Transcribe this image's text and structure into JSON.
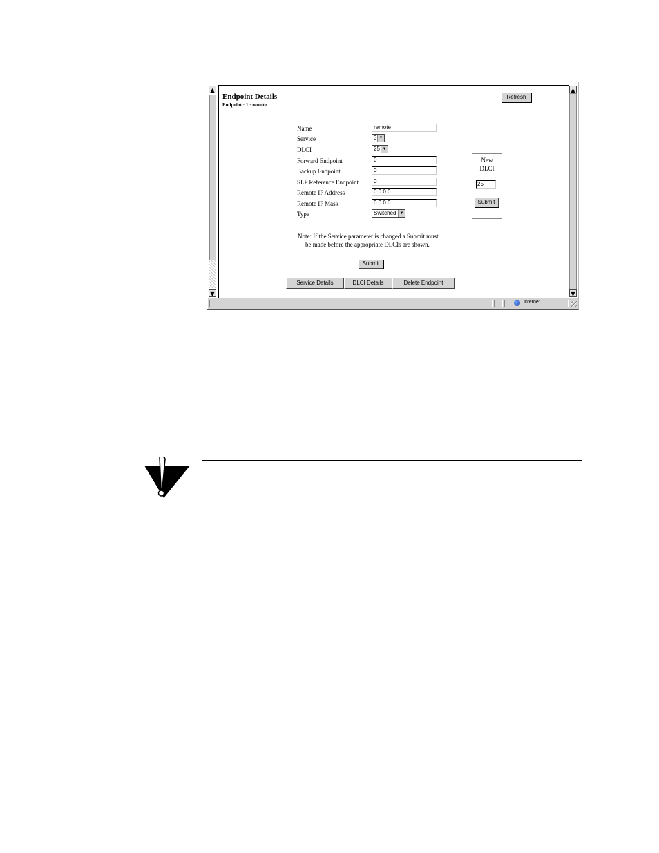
{
  "page": {
    "title": "Endpoint Details",
    "subtitle": "Endpoint : 1 : remote",
    "refresh_label": "Refresh"
  },
  "form": {
    "name_label": "Name",
    "name_value": "remote",
    "service_label": "Service",
    "service_value": "3",
    "dlci_label": "DLCI",
    "dlci_value": "25",
    "forward_label": "Forward Endpoint",
    "forward_value": "0",
    "backup_label": "Backup Endpoint",
    "backup_value": "0",
    "slp_label": "SLP Reference Endpoint",
    "slp_value": "0",
    "remote_ip_label": "Remote IP Address",
    "remote_ip_value": "0.0.0.0",
    "remote_mask_label": "Remote IP Mask",
    "remote_mask_value": "0.0.0.0",
    "type_label": "Type",
    "type_value": "Switched"
  },
  "new_dlci": {
    "label_line1": "New",
    "label_line2": "DLCI",
    "value": "25",
    "submit_label": "Submit"
  },
  "note": {
    "line1": "Note:  If the Service parameter is changed a Submit must",
    "line2": "be made before the appropriate DLCIs are shown."
  },
  "submit_label": "Submit",
  "tabs": [
    "Service Details",
    "DLCI Details",
    "Delete Endpoint"
  ],
  "status_bar": {
    "zone": "Internet"
  },
  "icons": {
    "scroll_up": "▲",
    "scroll_down": "▼",
    "dropdown": "▼"
  }
}
